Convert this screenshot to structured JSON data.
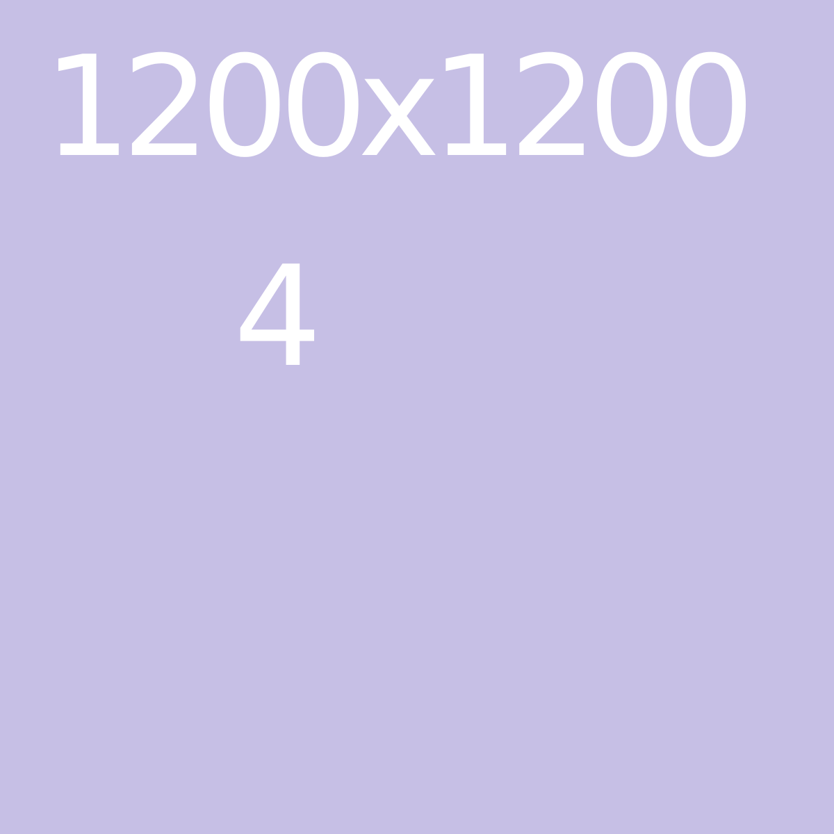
{
  "background_color": "#c6bfe5",
  "text_color": "#ffffff",
  "dimensions_text": "1200x1200",
  "index_text": "4"
}
